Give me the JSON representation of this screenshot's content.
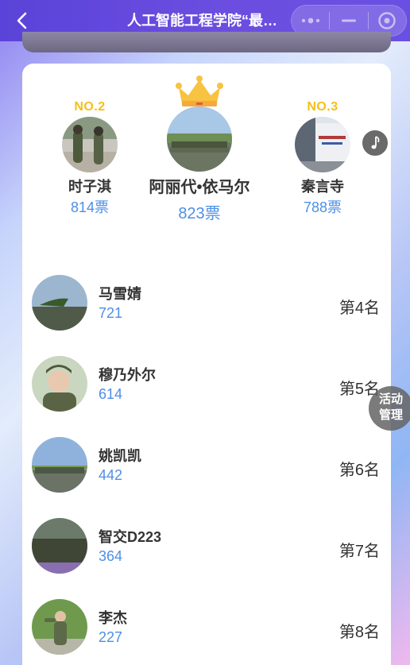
{
  "header": {
    "title": "人工智能工程学院“最美..."
  },
  "podium": [
    {
      "rank_label": "NO.2",
      "name": "时子淇",
      "votes": "814票"
    },
    {
      "rank_label": "",
      "name": "阿丽代•依马尔",
      "votes": "823票"
    },
    {
      "rank_label": "NO.3",
      "name": "秦言寺",
      "votes": "788票"
    }
  ],
  "list": [
    {
      "name": "马雪婧",
      "votes": "721",
      "rank": "第4名"
    },
    {
      "name": "穆乃外尔",
      "votes": "614",
      "rank": "第5名"
    },
    {
      "name": "姚凯凯",
      "votes": "442",
      "rank": "第6名"
    },
    {
      "name": "智交D223",
      "votes": "364",
      "rank": "第7名"
    },
    {
      "name": "李杰",
      "votes": "227",
      "rank": "第8名"
    }
  ],
  "floating": {
    "activity_label": "活动管理"
  },
  "colors": {
    "header": "#5a43d8",
    "rank_gold": "#f4c018",
    "votes_blue": "#4d8fe6",
    "text_dark": "#333333"
  },
  "icons": [
    "back-arrow-icon",
    "more-dots-icon",
    "minimize-icon",
    "close-target-icon",
    "crown-icon",
    "music-icon"
  ]
}
